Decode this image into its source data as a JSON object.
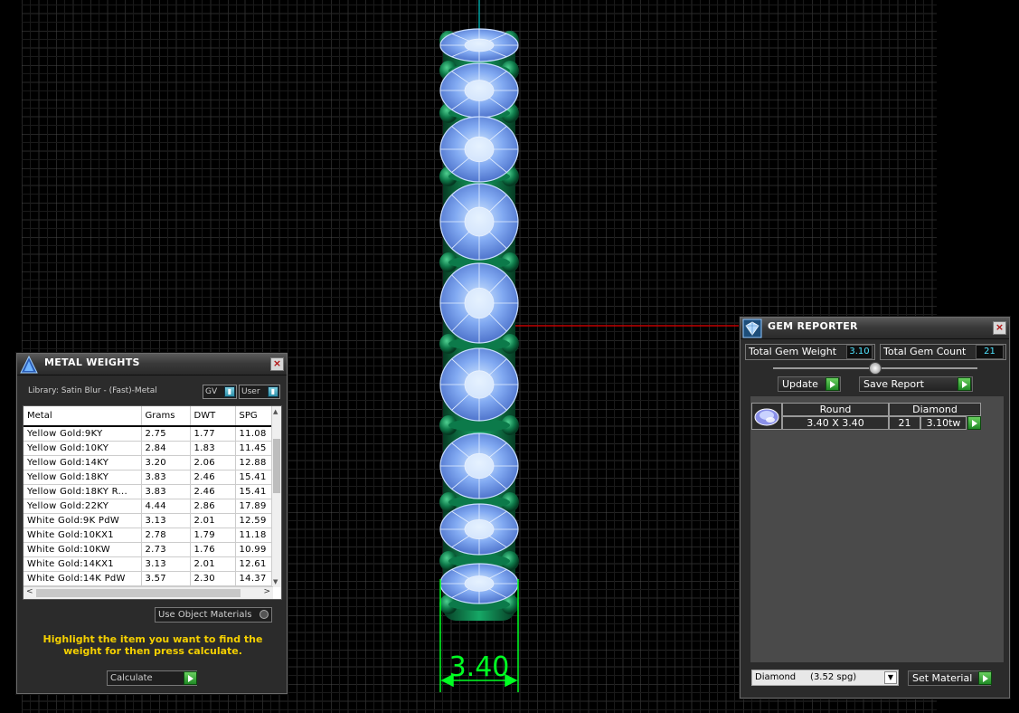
{
  "viewport": {
    "dimension_label": "3.40"
  },
  "metal_weights": {
    "title": "METAL WEIGHTS",
    "library": "Library: Satin Blur - (Fast)-Metal",
    "toggle_gv": "GV",
    "toggle_user": "User",
    "columns": [
      "Metal",
      "Grams",
      "DWT",
      "SPG"
    ],
    "rows": [
      [
        "Yellow Gold:9KY",
        "2.75",
        "1.77",
        "11.08"
      ],
      [
        "Yellow Gold:10KY",
        "2.84",
        "1.83",
        "11.45"
      ],
      [
        "Yellow Gold:14KY",
        "3.20",
        "2.06",
        "12.88"
      ],
      [
        "Yellow Gold:18KY",
        "3.83",
        "2.46",
        "15.41"
      ],
      [
        "Yellow Gold:18KY R...",
        "3.83",
        "2.46",
        "15.41"
      ],
      [
        "Yellow Gold:22KY",
        "4.44",
        "2.86",
        "17.89"
      ],
      [
        "White Gold:9K PdW",
        "3.13",
        "2.01",
        "12.59"
      ],
      [
        "White Gold:10KX1",
        "2.78",
        "1.79",
        "11.18"
      ],
      [
        "White Gold:10KW",
        "2.73",
        "1.76",
        "10.99"
      ],
      [
        "White Gold:14KX1",
        "3.13",
        "2.01",
        "12.61"
      ],
      [
        "White Gold:14K PdW",
        "3.57",
        "2.30",
        "14.37"
      ]
    ],
    "use_object_materials": "Use Object Materials",
    "hint": "Highlight the item you want to find the weight for then press calculate.",
    "calculate": "Calculate"
  },
  "gem_reporter": {
    "title": "GEM REPORTER",
    "total_gem_weight_label": "Total Gem Weight",
    "total_gem_weight": "3.10",
    "total_gem_count_label": "Total Gem Count",
    "total_gem_count": "21",
    "update": "Update",
    "save_report": "Save Report",
    "gem": {
      "shape": "Round",
      "material": "Diamond",
      "size": "3.40 X 3.40",
      "count": "21",
      "weight": "3.10tw"
    },
    "material_select": "Diamond     (3.52 spg)",
    "set_material": "Set Material"
  },
  "colors": {
    "stone": "#7aa8ff",
    "metal": "#0c7a4a",
    "dimension": "#00ff22",
    "hint": "#f5d000",
    "value": "#4ee4ff"
  },
  "icons": [
    "metal-weights-icon",
    "gem-reporter-icon",
    "close-icon",
    "go-arrow-icon",
    "dropdown-arrow-icon"
  ]
}
